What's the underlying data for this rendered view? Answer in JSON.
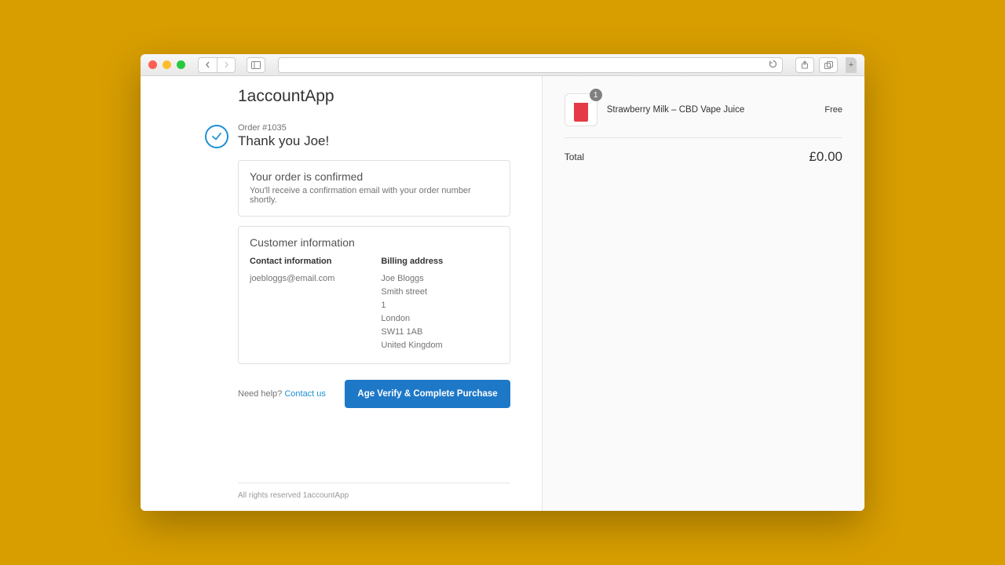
{
  "store_name": "1accountApp",
  "order": {
    "number_label": "Order #1035",
    "thankyou": "Thank you Joe!"
  },
  "confirm_card": {
    "title": "Your order is confirmed",
    "subtitle": "You'll receive a confirmation email with your order number shortly."
  },
  "customer_card": {
    "title": "Customer information",
    "contact_heading": "Contact information",
    "contact_email": "joebloggs@email.com",
    "billing_heading": "Billing address",
    "billing_name": "Joe Bloggs",
    "billing_street": "Smith street",
    "billing_unit": "1",
    "billing_city": "London",
    "billing_postcode": "SW11 1AB",
    "billing_country": "United Kingdom"
  },
  "help": {
    "label": "Need help? ",
    "link_text": "Contact us"
  },
  "primary_action": "Age Verify & Complete Purchase",
  "footer": "All rights reserved 1accountApp",
  "line_item": {
    "name": "Strawberry Milk – CBD Vape Juice",
    "price": "Free",
    "qty": "1"
  },
  "total": {
    "label": "Total",
    "value": "£0.00"
  }
}
